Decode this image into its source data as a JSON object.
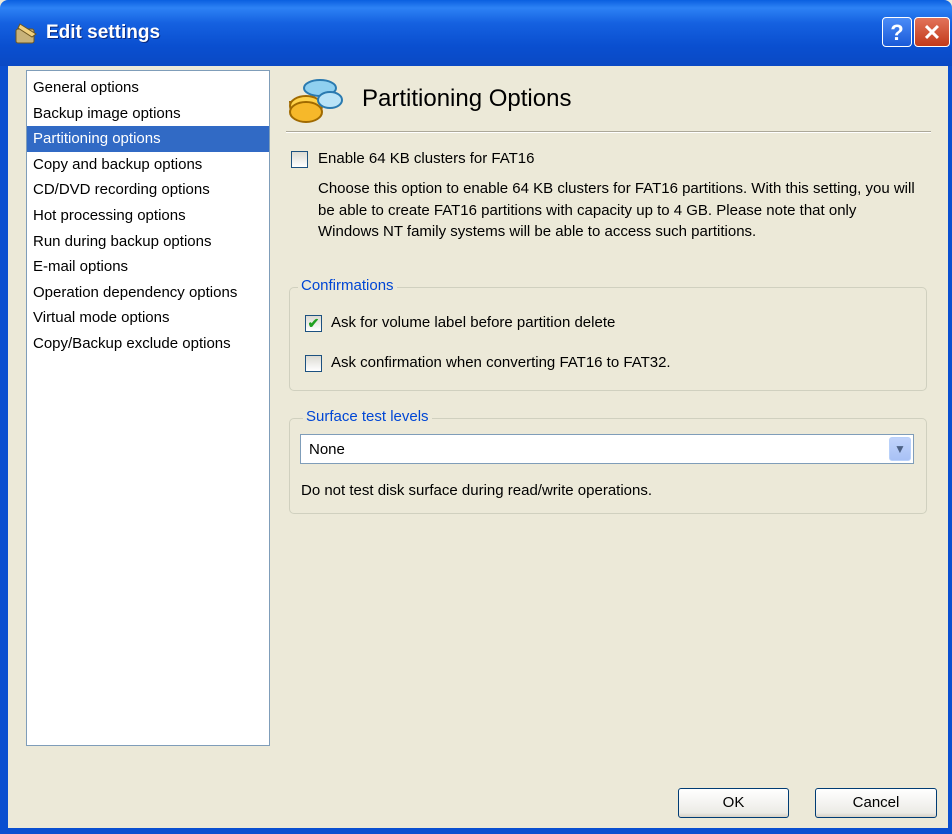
{
  "window": {
    "title": "Edit settings",
    "help_glyph": "?",
    "close_glyph": "✕"
  },
  "nav": {
    "items": [
      "General options",
      "Backup image options",
      "Partitioning options",
      "Copy and backup options",
      "CD/DVD recording options",
      "Hot processing options",
      "Run during backup options",
      "E-mail options",
      "Operation dependency options",
      "Virtual mode options",
      "Copy/Backup exclude options"
    ],
    "selected_index": 2
  },
  "page": {
    "title": "Partitioning Options",
    "fat16": {
      "label": "Enable 64 KB clusters for FAT16",
      "checked": false,
      "description": "Choose this option to enable 64 KB clusters for FAT16 partitions. With this setting, you will be able to create FAT16 partitions with capacity up to 4 GB. Please note that only Windows NT family systems will be able to access such partitions."
    },
    "confirmations": {
      "title": "Confirmations",
      "volume_label": {
        "label": "Ask for volume label before partition delete",
        "checked": true
      },
      "convert": {
        "label": "Ask confirmation when converting FAT16 to FAT32.",
        "checked": false
      }
    },
    "surface": {
      "title": "Surface test levels",
      "selected": "None",
      "description": "Do not test disk surface during read/write operations."
    }
  },
  "buttons": {
    "ok": "OK",
    "cancel": "Cancel"
  },
  "colors": {
    "titlebar": "#0a4fd0",
    "selection": "#316ac5",
    "dialog_bg": "#ece9d8",
    "group_title": "#0046d5"
  }
}
